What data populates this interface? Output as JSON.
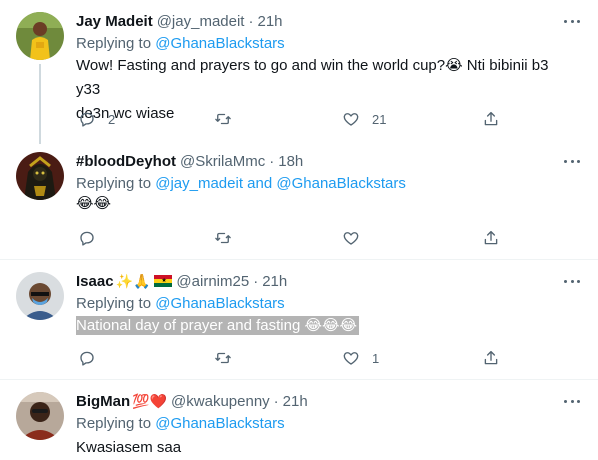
{
  "tweets": [
    {
      "name": "Jay Madeit",
      "handle": "@jay_madeit",
      "dot": "·",
      "time": "21h",
      "replying_prefix": "Replying to",
      "mention_1": "@GhanaBlackstars",
      "line_1": "Wow! Fasting and prayers to go and win the world cup?😭 Nti bibinii b3 y33",
      "line_2": "de3n wc wiase",
      "reply_count": "2",
      "retweet_count": "",
      "like_count": "21"
    },
    {
      "name": "#bloodDeyhot",
      "handle": "@SkrilaMmc",
      "dot": "·",
      "time": "18h",
      "replying_prefix": "Replying to",
      "mention_1": "@jay_madeit",
      "mention_joiner": "and",
      "mention_2": "@GhanaBlackstars",
      "line_1": "😂😂",
      "reply_count": "",
      "retweet_count": "",
      "like_count": ""
    },
    {
      "name": "Isaac",
      "name_emoji": "✨🙏",
      "handle": "@airnim25",
      "dot": "·",
      "time": "21h",
      "replying_prefix": "Replying to",
      "mention_1": "@GhanaBlackstars",
      "line_1": "National day of prayer and fasting 😂😂😂",
      "reply_count": "",
      "retweet_count": "",
      "like_count": "1"
    },
    {
      "name": "BigMan",
      "name_emoji": "💯❤️",
      "handle": "@kwakupenny",
      "dot": "·",
      "time": "21h",
      "replying_prefix": "Replying to",
      "mention_1": "@GhanaBlackstars",
      "line_1": "Kwasiasem saa"
    }
  ],
  "icons": {
    "reply": "reply-icon",
    "retweet": "retweet-icon",
    "like": "heart-icon",
    "share": "share-icon",
    "more": "more-icon"
  },
  "colors": {
    "accent": "#1d9bf0",
    "secondary_text": "#536471",
    "divider": "#eff3f4"
  }
}
